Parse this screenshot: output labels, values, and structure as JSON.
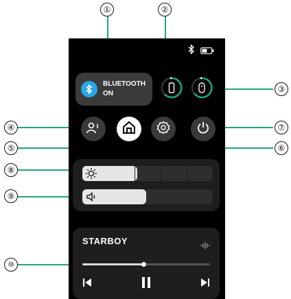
{
  "callouts": {
    "c1": "①",
    "c2": "②",
    "c3": "③",
    "c4": "④",
    "c5": "⑤",
    "c6": "⑥",
    "c7": "⑦",
    "c8": "⑧",
    "c9": "⑨",
    "c10": "⑩"
  },
  "bluetooth": {
    "line1": "BLUETOOTH",
    "line2": "ON",
    "icon": "bluetooth-icon"
  },
  "status_icons": [
    "bluetooth-icon",
    "battery-icon"
  ],
  "buttons": [
    {
      "icon": "earbuds-icon",
      "active": false
    },
    {
      "icon": "home-icon",
      "active": true
    },
    {
      "icon": "gear-icon",
      "active": false
    },
    {
      "icon": "power-icon",
      "active": false
    }
  ],
  "brightness": {
    "icon": "sun-icon",
    "level": 0.42
  },
  "volume": {
    "icon": "speaker-icon",
    "level": 0.49
  },
  "music": {
    "title": "STARBOY",
    "progress": 0.48
  },
  "colors": {
    "accent": "#1fa57f",
    "bluetooth": "#2aa6e6"
  }
}
